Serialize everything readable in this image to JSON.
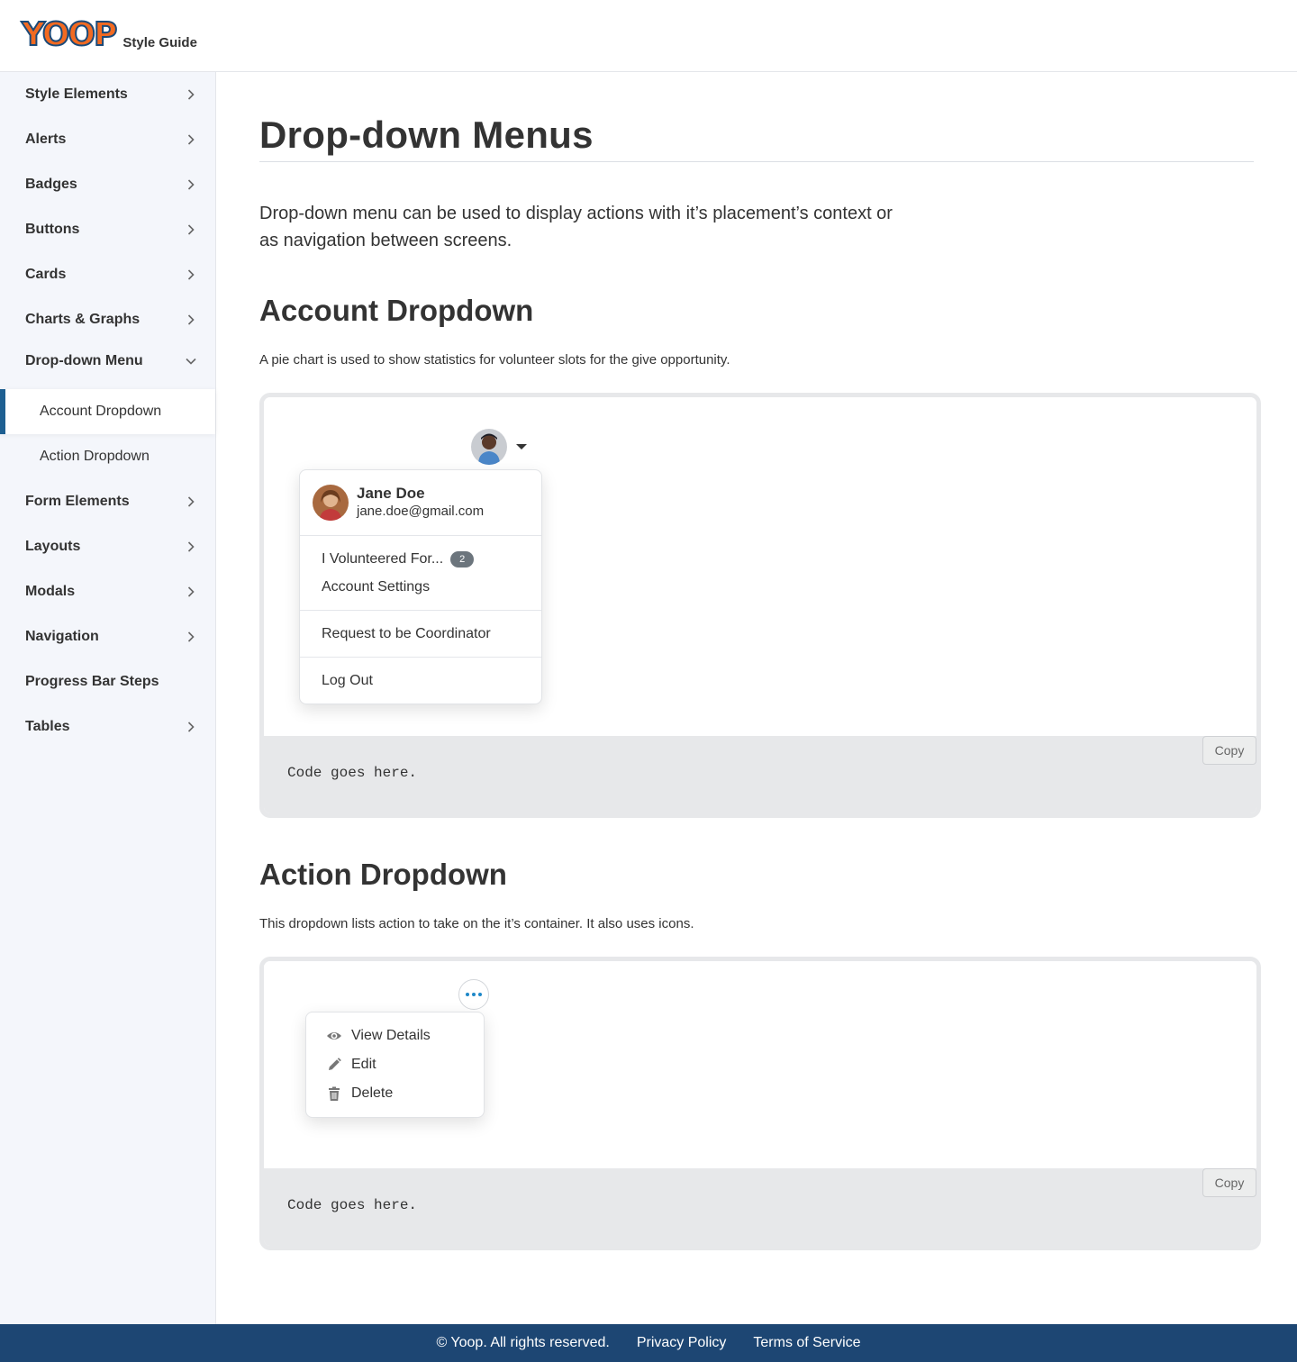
{
  "header": {
    "logo_text": "YOOP",
    "subtitle": "Style Guide"
  },
  "sidebar": {
    "items": [
      {
        "label": "Style Elements"
      },
      {
        "label": "Alerts"
      },
      {
        "label": "Badges"
      },
      {
        "label": "Buttons"
      },
      {
        "label": "Cards"
      },
      {
        "label": "Charts & Graphs"
      },
      {
        "label": "Drop-down Menu"
      },
      {
        "label": "Form Elements"
      },
      {
        "label": "Layouts"
      },
      {
        "label": "Modals"
      },
      {
        "label": "Navigation"
      },
      {
        "label": "Progress Bar Steps"
      },
      {
        "label": "Tables"
      }
    ],
    "sub_items": [
      {
        "label": "Account Dropdown"
      },
      {
        "label": "Action Dropdown"
      }
    ],
    "active_color": "#1e5f91"
  },
  "main": {
    "title": "Drop-down Menus",
    "intro": "Drop-down menu can be used to display actions with it’s placement’s context or as navigation between screens.",
    "account": {
      "heading": "Account Dropdown",
      "description": "A pie chart is used to show statistics for volunteer slots for the give opportunity.",
      "user_name": "Jane Doe",
      "user_email": "jane.doe@gmail.com",
      "menu": {
        "volunteered": "I Volunteered For...",
        "volunteered_count": "2",
        "settings": "Account Settings",
        "coordinator": "Request to be Coordinator",
        "logout": "Log Out"
      },
      "code": "Code goes here.",
      "copy": "Copy"
    },
    "action": {
      "heading": "Action Dropdown",
      "description": "This dropdown lists action to take on the it’s container. It also uses icons.",
      "menu": {
        "view": "View Details",
        "edit": "Edit",
        "delete": "Delete"
      },
      "code": "Code goes here.",
      "copy": "Copy"
    }
  },
  "footer": {
    "copyright": "© Yoop. All rights reserved.",
    "privacy": "Privacy Policy",
    "terms": "Terms of Service"
  },
  "colors": {
    "brand_orange": "#f26a21",
    "brand_navy": "#1d4673",
    "accent_blue": "#1e88c8"
  },
  "icons": [
    "chevron-right-icon",
    "chevron-down-icon",
    "caret-down-icon",
    "more-dots-icon",
    "eye-icon",
    "pencil-icon",
    "trash-icon"
  ]
}
